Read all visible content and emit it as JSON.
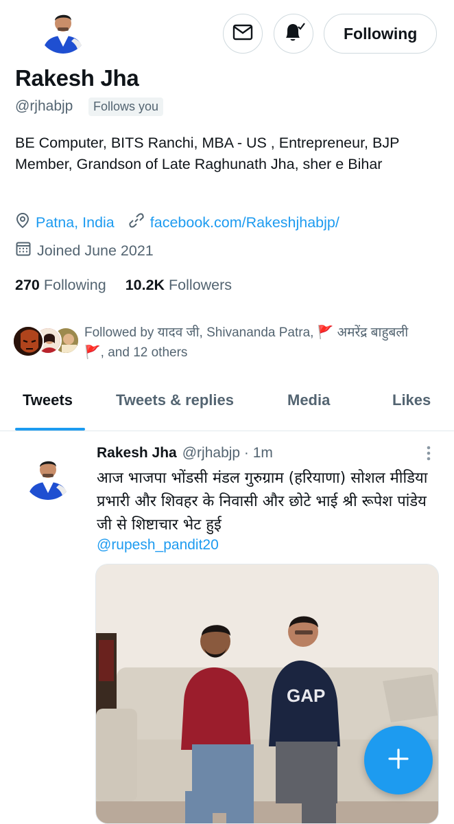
{
  "profile": {
    "name": "Rakesh Jha",
    "handle": "@rjhabjp",
    "follows_you": "Follows you",
    "bio": "BE Computer, BITS Ranchi, MBA - US , Entrepreneur, BJP Member, Grandson of Late Raghunath Jha, sher e Bihar",
    "location": "Patna, India",
    "website": "facebook.com/Rakeshjhabjp/",
    "joined": "Joined June 2021",
    "following_count": "270",
    "following_label": "Following",
    "followers_count": "10.2K",
    "followers_label": "Followers",
    "followed_by": "Followed by यादव जी, Shivananda Patra, 🚩 अमरेंद्र बाहुबली 🚩, and 12 others"
  },
  "actions": {
    "following_button": "Following",
    "message_icon": "envelope-icon",
    "notify_icon": "bell-check-icon"
  },
  "tabs": [
    {
      "label": "Tweets"
    },
    {
      "label": "Tweets & replies"
    },
    {
      "label": "Media"
    },
    {
      "label": "Likes"
    }
  ],
  "tweet": {
    "name": "Rakesh Jha",
    "handle_time": "@rjhabjp · 1m",
    "text": "आज भाजपा भोंडसी मंडल गुरुग्राम (हरियाणा) सोशल मीडिया प्रभारी और शिवहर के निवासी और छोटे भाई श्री रूपेश पांडेय जी से शिष्टाचार भेट हुई",
    "mention": "@rupesh_pandit20"
  },
  "colors": {
    "accent": "#1d9bf0",
    "text": "#0f1419",
    "secondary": "#536471"
  }
}
